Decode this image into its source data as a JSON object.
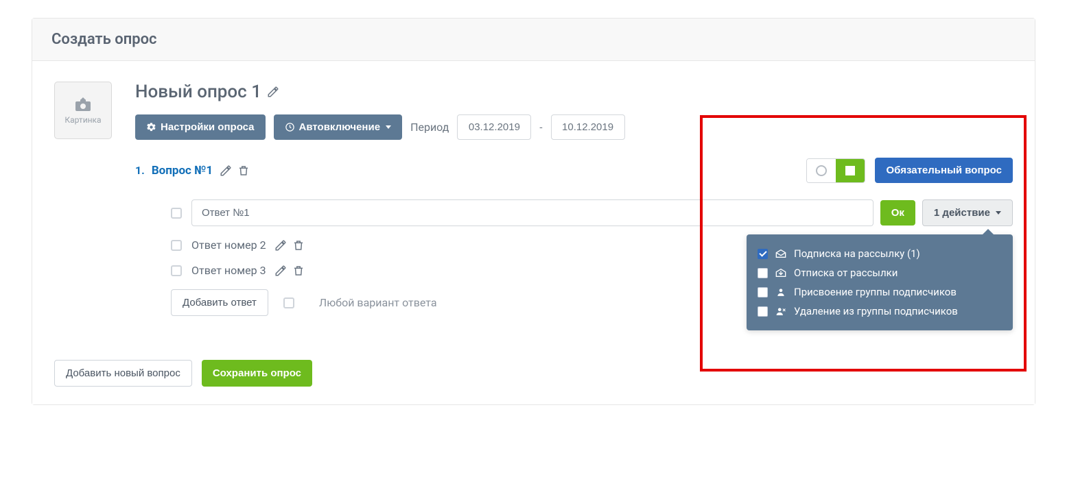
{
  "header": {
    "title": "Создать опрос"
  },
  "uploader": {
    "label": "Картинка"
  },
  "poll": {
    "title": "Новый опрос 1",
    "settings_btn": "Настройки опроса",
    "auto_btn": "Автовключение",
    "period_label": "Период",
    "date_from": "03.12.2019",
    "date_to": "10.12.2019"
  },
  "question": {
    "number": "1.",
    "title": "Вопрос №1",
    "required_btn": "Обязательный вопрос"
  },
  "answers": {
    "a1_value": "Ответ №1",
    "ok_btn": "Ок",
    "actions_btn": "1 действие",
    "a2_text": "Ответ номер 2",
    "a3_text": "Ответ номер 3",
    "add_btn": "Добавить ответ",
    "any_label": "Любой вариант ответа"
  },
  "actions_menu": {
    "subscribe": "Подписка на рассылку (1)",
    "unsubscribe": "Отписка от рассылки",
    "assign_group": "Присвоение группы подписчиков",
    "remove_group": "Удаление из группы подписчиков"
  },
  "footer": {
    "add_question": "Добавить новый вопрос",
    "save_poll": "Сохранить опрос"
  }
}
